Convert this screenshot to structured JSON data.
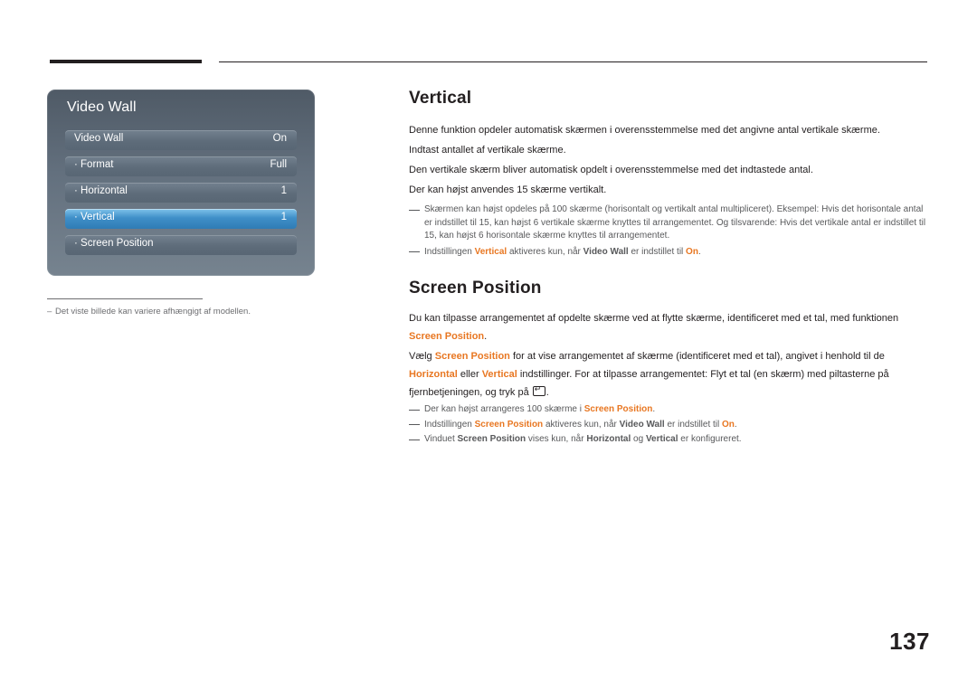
{
  "osd": {
    "title": "Video Wall",
    "rows": [
      {
        "label": "Video Wall",
        "value": "On",
        "selected": false
      },
      {
        "label": "· Format",
        "value": "Full",
        "selected": false
      },
      {
        "label": "· Horizontal",
        "value": "1",
        "selected": false
      },
      {
        "label": "· Vertical",
        "value": "1",
        "selected": true
      },
      {
        "label": "· Screen Position",
        "value": "",
        "selected": false
      }
    ],
    "footnote": "Det viste billede kan variere afhængigt af modellen."
  },
  "sections": {
    "vertical": {
      "heading": "Vertical",
      "p1": "Denne funktion opdeler automatisk skærmen i overensstemmelse med det angivne antal vertikale skærme.",
      "p2": "Indtast antallet af vertikale skærme.",
      "p3": "Den vertikale skærm bliver automatisk opdelt i overensstemmelse med det indtastede antal.",
      "p4": "Der kan højst anvendes 15 skærme vertikalt.",
      "note1": "Skærmen kan højst opdeles på 100 skærme (horisontalt og vertikalt antal multipliceret). Eksempel: Hvis det horisontale antal er indstillet til 15, kan højst 6 vertikale skærme knyttes til arrangementet. Og tilsvarende: Hvis det vertikale antal er indstillet til 15, kan højst 6 horisontale skærme knyttes til arrangementet.",
      "note2_a": "Indstillingen ",
      "note2_b": "Vertical",
      "note2_c": " aktiveres kun, når ",
      "note2_d": "Video Wall",
      "note2_e": " er indstillet til ",
      "note2_f": "On",
      "note2_g": "."
    },
    "screen_position": {
      "heading": "Screen Position",
      "p1_a": "Du kan tilpasse arrangementet af opdelte skærme ved at flytte skærme, identificeret med et tal, med funktionen ",
      "p1_b": "Screen Position",
      "p1_c": ".",
      "p2_a": "Vælg ",
      "p2_b": "Screen Position",
      "p2_c": " for at vise arrangementet af skærme (identificeret med et tal), angivet i henhold til de ",
      "p2_d": "Horizontal",
      "p2_e": " eller ",
      "p2_f": "Vertical",
      "p2_g": " indstillinger. For at tilpasse arrangementet: Flyt et tal (en skærm) med piltasterne på fjernbetjeningen, og tryk på ",
      "p2_h": ".",
      "note1_a": "Der kan højst arrangeres 100 skærme i ",
      "note1_b": "Screen Position",
      "note1_c": ".",
      "note2_a": "Indstillingen ",
      "note2_b": "Screen Position",
      "note2_c": " aktiveres kun, når ",
      "note2_d": "Video Wall",
      "note2_e": " er indstillet til ",
      "note2_f": "On",
      "note2_g": ".",
      "note3_a": "Vinduet ",
      "note3_b": "Screen Position",
      "note3_c": " vises kun, når ",
      "note3_d": "Horizontal",
      "note3_e": " og ",
      "note3_f": "Vertical",
      "note3_g": " er konfigureret."
    }
  },
  "page_number": "137"
}
